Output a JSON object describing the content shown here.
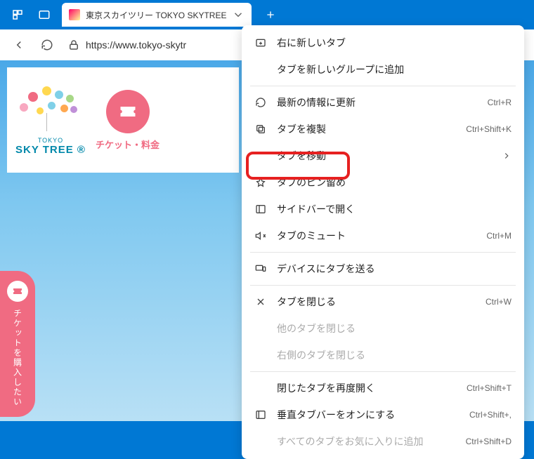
{
  "tab": {
    "title": "東京スカイツリー TOKYO SKYTREE"
  },
  "url": "https://www.tokyo-skytr",
  "logo": {
    "small": "TOKYO",
    "main": "SKY TREE ®"
  },
  "ticket": {
    "label": "チケット・料金"
  },
  "sidebadge": {
    "text": "チケットを購入したい"
  },
  "menu": {
    "newTab": "右に新しいタブ",
    "addGroup": "タブを新しいグループに追加",
    "refresh": "最新の情報に更新",
    "refreshKey": "Ctrl+R",
    "duplicate": "タブを複製",
    "dupKey": "Ctrl+Shift+K",
    "move": "タブを移動",
    "pin": "タブのピン留め",
    "sidebar": "サイドバーで開く",
    "mute": "タブのミュート",
    "muteKey": "Ctrl+M",
    "sendDevice": "デバイスにタブを送る",
    "close": "タブを閉じる",
    "closeKey": "Ctrl+W",
    "closeOther": "他のタブを閉じる",
    "closeRight": "右側のタブを閉じる",
    "reopen": "閉じたタブを再度開く",
    "reopenKey": "Ctrl+Shift+T",
    "vertical": "垂直タブバーをオンにする",
    "verticalKey": "Ctrl+Shift+,",
    "favAll": "すべてのタブをお気に入りに追加",
    "favKey": "Ctrl+Shift+D"
  }
}
